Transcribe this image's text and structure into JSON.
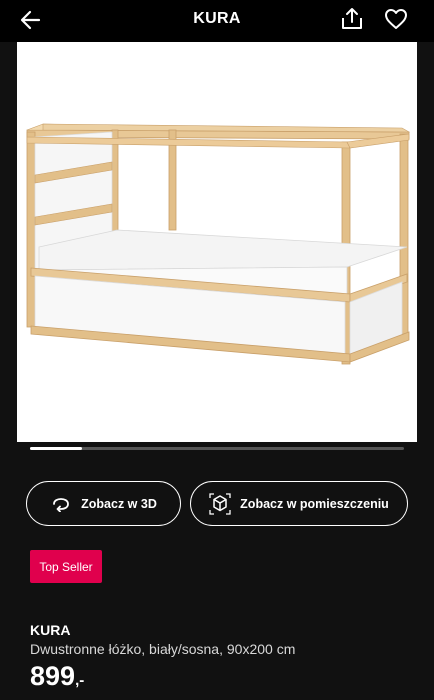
{
  "header": {
    "title": "KURA"
  },
  "product_image": {
    "alt": "bed"
  },
  "carousel": {
    "progress": 0.14
  },
  "actions": {
    "view_3d": "Zobacz w 3D",
    "view_in_room": "Zobacz w pomieszczeniu"
  },
  "badge": {
    "label": "Top Seller",
    "color": "#e0004d"
  },
  "product": {
    "name": "KURA",
    "description": "Dwustronne łóżko, biały/sosna, 90x200 cm",
    "price": "899",
    "price_suffix": ",-"
  }
}
